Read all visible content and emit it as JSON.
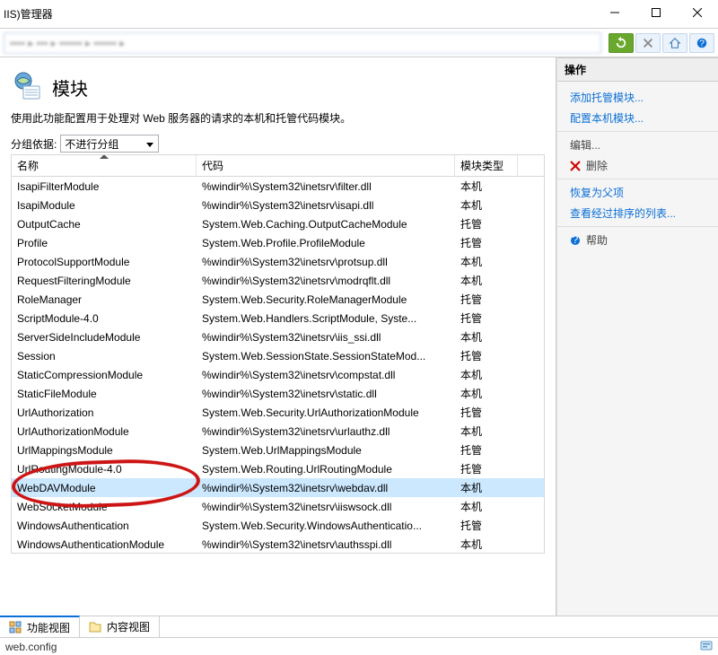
{
  "window": {
    "title": "IIS)管理器"
  },
  "breadcrumb": {
    "blurred": "▪▪▪▪  ▸  ▪▪▪  ▸  ▪▪▪▪▪▪  ▸  ▪▪▪▪▪▪  ▸"
  },
  "page": {
    "title": "模块",
    "desc": "使用此功能配置用于处理对 Web 服务器的请求的本机和托管代码模块。",
    "group_label": "分组依据:",
    "group_value": "不进行分组"
  },
  "columns": {
    "name": "名称",
    "code": "代码",
    "type": "模块类型"
  },
  "rows": [
    {
      "name": "IsapiFilterModule",
      "code": "%windir%\\System32\\inetsrv\\filter.dll",
      "type": "本机",
      "sel": false
    },
    {
      "name": "IsapiModule",
      "code": "%windir%\\System32\\inetsrv\\isapi.dll",
      "type": "本机",
      "sel": false
    },
    {
      "name": "OutputCache",
      "code": "System.Web.Caching.OutputCacheModule",
      "type": "托管",
      "sel": false
    },
    {
      "name": "Profile",
      "code": "System.Web.Profile.ProfileModule",
      "type": "托管",
      "sel": false
    },
    {
      "name": "ProtocolSupportModule",
      "code": "%windir%\\System32\\inetsrv\\protsup.dll",
      "type": "本机",
      "sel": false
    },
    {
      "name": "RequestFilteringModule",
      "code": "%windir%\\System32\\inetsrv\\modrqflt.dll",
      "type": "本机",
      "sel": false
    },
    {
      "name": "RoleManager",
      "code": "System.Web.Security.RoleManagerModule",
      "type": "托管",
      "sel": false
    },
    {
      "name": "ScriptModule-4.0",
      "code": "System.Web.Handlers.ScriptModule, Syste...",
      "type": "托管",
      "sel": false
    },
    {
      "name": "ServerSideIncludeModule",
      "code": "%windir%\\System32\\inetsrv\\iis_ssi.dll",
      "type": "本机",
      "sel": false
    },
    {
      "name": "Session",
      "code": "System.Web.SessionState.SessionStateMod...",
      "type": "托管",
      "sel": false
    },
    {
      "name": "StaticCompressionModule",
      "code": "%windir%\\System32\\inetsrv\\compstat.dll",
      "type": "本机",
      "sel": false
    },
    {
      "name": "StaticFileModule",
      "code": "%windir%\\System32\\inetsrv\\static.dll",
      "type": "本机",
      "sel": false
    },
    {
      "name": "UrlAuthorization",
      "code": "System.Web.Security.UrlAuthorizationModule",
      "type": "托管",
      "sel": false
    },
    {
      "name": "UrlAuthorizationModule",
      "code": "%windir%\\System32\\inetsrv\\urlauthz.dll",
      "type": "本机",
      "sel": false
    },
    {
      "name": "UrlMappingsModule",
      "code": "System.Web.UrlMappingsModule",
      "type": "托管",
      "sel": false
    },
    {
      "name": "UrlRoutingModule-4.0",
      "code": "System.Web.Routing.UrlRoutingModule",
      "type": "托管",
      "sel": false
    },
    {
      "name": "WebDAVModule",
      "code": "%windir%\\System32\\inetsrv\\webdav.dll",
      "type": "本机",
      "sel": true
    },
    {
      "name": "WebSocketModule",
      "code": "%windir%\\System32\\inetsrv\\iiswsock.dll",
      "type": "本机",
      "sel": false
    },
    {
      "name": "WindowsAuthentication",
      "code": "System.Web.Security.WindowsAuthenticatio...",
      "type": "托管",
      "sel": false
    },
    {
      "name": "WindowsAuthenticationModule",
      "code": "%windir%\\System32\\inetsrv\\authsspi.dll",
      "type": "本机",
      "sel": false
    }
  ],
  "actions": {
    "header": "操作",
    "add": "添加托管模块...",
    "configure": "配置本机模块...",
    "edit": "编辑...",
    "delete": "删除",
    "revert": "恢复为父项",
    "sorted": "查看经过排序的列表...",
    "help": "帮助"
  },
  "tabs": {
    "features": "功能视图",
    "content": "内容视图"
  },
  "status": {
    "text": "web.config"
  }
}
